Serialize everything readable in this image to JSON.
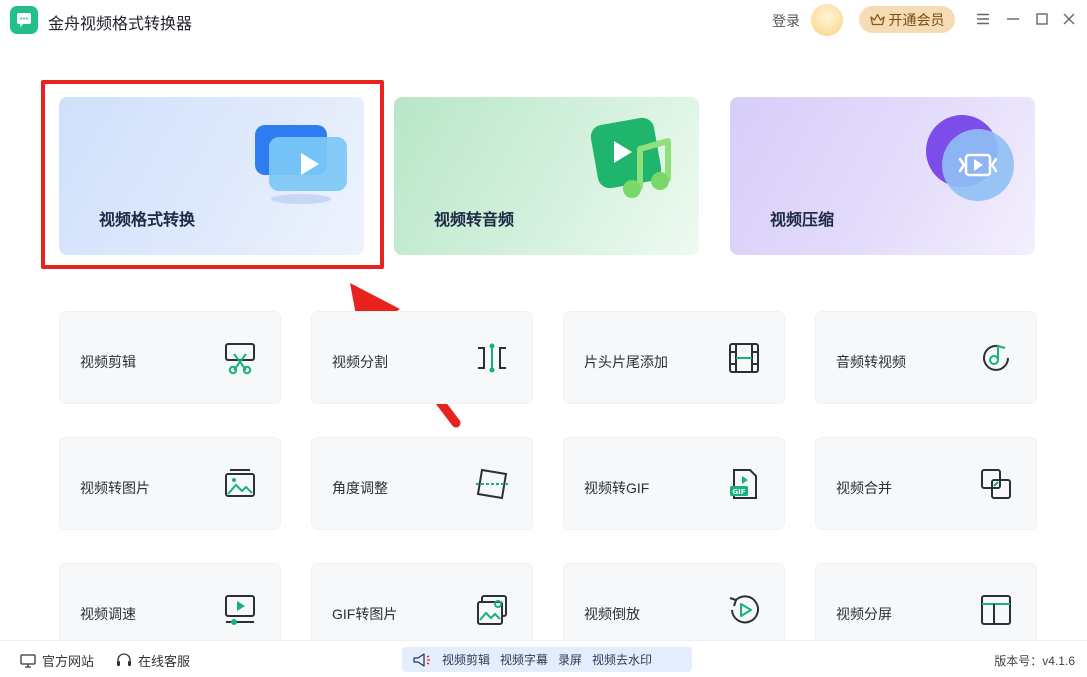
{
  "app": {
    "title": "金舟视频格式转换器"
  },
  "header": {
    "login": "登录",
    "vip": "开通会员"
  },
  "big_cards": [
    {
      "label": "视频格式转换"
    },
    {
      "label": "视频转音频"
    },
    {
      "label": "视频压缩"
    }
  ],
  "tools": [
    {
      "label": "视频剪辑",
      "icon": "scissors-icon"
    },
    {
      "label": "视频分割",
      "icon": "split-icon"
    },
    {
      "label": "片头片尾添加",
      "icon": "film-icon"
    },
    {
      "label": "音频转视频",
      "icon": "music-disc-icon"
    },
    {
      "label": "视频转图片",
      "icon": "image-icon"
    },
    {
      "label": "角度调整",
      "icon": "rotate-frame-icon"
    },
    {
      "label": "视频转GIF",
      "icon": "gif-file-icon"
    },
    {
      "label": "视频合并",
      "icon": "merge-icon"
    },
    {
      "label": "视频调速",
      "icon": "speed-monitor-icon"
    },
    {
      "label": "GIF转图片",
      "icon": "gallery-icon"
    },
    {
      "label": "视频倒放",
      "icon": "reverse-play-icon"
    },
    {
      "label": "视频分屏",
      "icon": "split-screen-icon"
    }
  ],
  "footer": {
    "website": "官方网站",
    "support": "在线客服",
    "promo": [
      "视频剪辑",
      "视频字幕",
      "录屏",
      "视频去水印"
    ],
    "version": "版本号：v4.1.6"
  },
  "colors": {
    "accent": "#21c08b",
    "highlight": "#e8231e",
    "vip": "#f6dcb4"
  }
}
